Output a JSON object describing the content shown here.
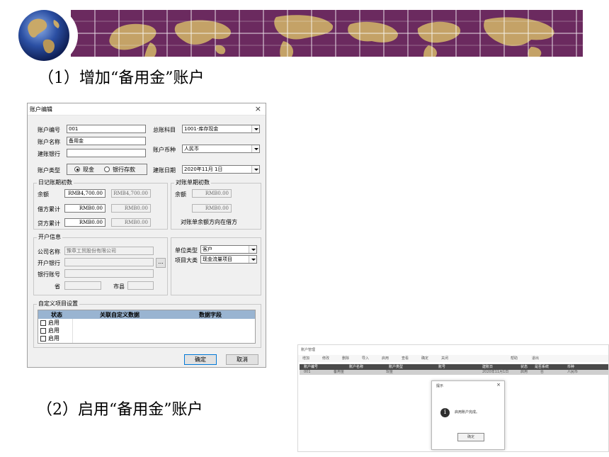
{
  "slide": {
    "step1": "（1）增加“备用金”账户",
    "step2": "（2）启用“备用金”账户"
  },
  "dialog": {
    "title": "账户编辑",
    "close": "×",
    "labels": {
      "account_no": "账户编号",
      "account_name": "账户名称",
      "bank": "建账银行",
      "account_type": "账户类型",
      "gl_subject": "总账科目",
      "currency": "账户币种",
      "open_date": "建账日期"
    },
    "values": {
      "account_no": "001",
      "account_name": "备用金",
      "bank": "",
      "gl_subject": "1001-库存现金",
      "currency": "人民币",
      "open_date": "2020年11月 1日"
    },
    "radio": {
      "cash": "现金",
      "bank_deposit": "银行存款",
      "selected": "cash"
    },
    "journal_group": {
      "title": "日记账期初数",
      "balance_label": "余额",
      "debit_label": "借方累计",
      "credit_label": "贷方累计",
      "balance": "RMB4,700.00",
      "balance2": "RMB4,700.00",
      "debit": "RMB0.00",
      "debit2": "RMB0.00",
      "credit": "RMB0.00",
      "credit2": "RMB0.00"
    },
    "statement_group": {
      "title": "对账单期初数",
      "balance_label": "余额",
      "balance": "RMB0.00",
      "balance2": "RMB0.00",
      "note": "对账单余额方向在借方"
    },
    "open_info": {
      "title": "开户信息",
      "company_label": "公司名称",
      "company_value": "豫章工贸股份有限公司",
      "bank_label": "开户银行",
      "bank_value": "",
      "ellipsis": "...",
      "account_label": "银行账号",
      "province_label": "省",
      "city_label": "市县",
      "unit_type_label": "单位类型",
      "unit_type_value": "客户",
      "item_class_label": "项目大类",
      "item_class_value": "现金流量项目"
    },
    "custom": {
      "title": "自定义项目设置",
      "columns": [
        "状态",
        "关联自定义数据",
        "数据字段"
      ],
      "rows": [
        "启用",
        "启用",
        "启用"
      ]
    },
    "buttons": {
      "ok": "确定",
      "cancel": "取消"
    }
  },
  "screenshot": {
    "title": "账户管理",
    "toolbar": [
      "增加",
      "修改",
      "删除",
      "导入",
      "启用",
      "查看",
      "确定",
      "关闭",
      "帮助",
      "退出"
    ],
    "columns": [
      "账户编号",
      "账户名称",
      "账户类型",
      "账号",
      "建账日",
      "状态",
      "是否系统",
      "币种"
    ],
    "row": [
      "001",
      "备用金",
      "现金",
      "",
      "2020年11月1日",
      "启用",
      "否",
      "人民币"
    ],
    "message": {
      "title": "提示",
      "close": "×",
      "text": "启用账户完成。",
      "ok": "确定"
    }
  },
  "colors": {
    "banner": "#6b2a5f",
    "land": "#c9a968",
    "table_header": "#99b4d1"
  }
}
